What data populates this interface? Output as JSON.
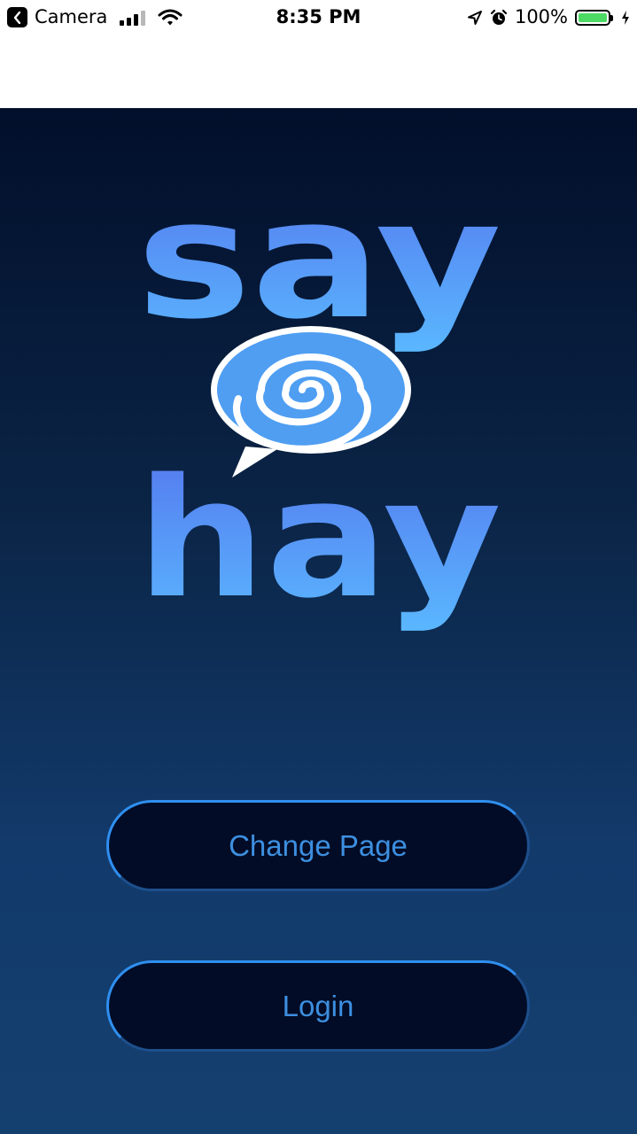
{
  "status_bar": {
    "back_label": "Camera",
    "time": "8:35 PM",
    "battery_percent": "100%",
    "battery_level": 1.0,
    "signal_bars_active": 3,
    "signal_bars_total": 4,
    "icons": [
      "back-chevron-icon",
      "signal-icon",
      "wifi-icon",
      "location-arrow-icon",
      "alarm-clock-icon",
      "battery-icon",
      "charging-bolt-icon"
    ]
  },
  "logo": {
    "line1": "say",
    "line2": "hay",
    "icon": "spiral-speech-bubble-icon"
  },
  "buttons": {
    "change_page": "Change Page",
    "login": "Login"
  },
  "colors": {
    "background_top": "#020f2b",
    "background_bottom": "#14406f",
    "logo_gradient_top": "#5577ee",
    "logo_gradient_bottom": "#5ab8ff",
    "button_fill": "#020c26",
    "button_border": "#2f8ff0",
    "button_text": "#3d8fe0",
    "battery_green": "#4cd964"
  }
}
